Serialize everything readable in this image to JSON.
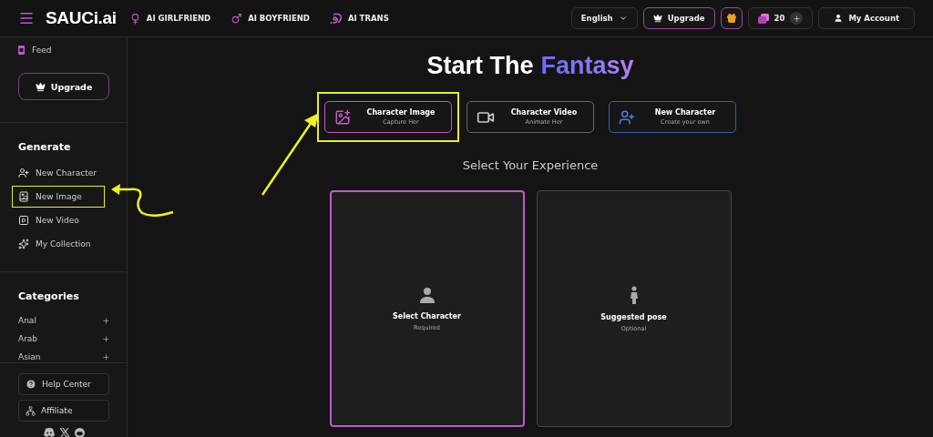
{
  "header": {
    "logo": "SAUCi.ai",
    "nav": [
      {
        "label": "AI GIRLFRIEND",
        "kind": "female"
      },
      {
        "label": "AI BOYFRIEND",
        "kind": "male"
      },
      {
        "label": "AI TRANS",
        "kind": "trans"
      }
    ],
    "language": "English",
    "upgrade": "Upgrade",
    "credits": "20",
    "account": "My Account"
  },
  "sidebar": {
    "feed": "Feed",
    "upgrade": "Upgrade",
    "generate_title": "Generate",
    "generate_items": [
      {
        "label": "New Character",
        "kind": "character",
        "highlighted": false
      },
      {
        "label": "New Image",
        "kind": "image",
        "highlighted": true
      },
      {
        "label": "New Video",
        "kind": "video",
        "highlighted": false
      },
      {
        "label": "My Collection",
        "kind": "collection",
        "highlighted": false
      }
    ],
    "categories_title": "Categories",
    "categories": [
      {
        "label": "Anal",
        "expanded": false
      },
      {
        "label": "Arab",
        "expanded": false
      },
      {
        "label": "Asian",
        "expanded": false
      }
    ],
    "help": "Help Center",
    "affiliate": "Affiliate"
  },
  "main": {
    "title": "Start The",
    "title_accent": "Fantasy",
    "modes": [
      {
        "title": "Character Image",
        "subtitle": "Capture Her",
        "kind": "image",
        "selected": true,
        "highlighted": true
      },
      {
        "title": "Character Video",
        "subtitle": "Animate Her",
        "kind": "video",
        "selected": false,
        "highlighted": false
      },
      {
        "title": "New Character",
        "subtitle": "Create your own",
        "kind": "create",
        "selected": false,
        "highlighted": false
      }
    ],
    "section_title": "Select Your Experience",
    "cards": [
      {
        "title": "Select Character",
        "subtitle": "Required",
        "kind": "character",
        "selected": true
      },
      {
        "title": "Suggested pose",
        "subtitle": "Optional",
        "kind": "pose",
        "selected": false
      }
    ]
  }
}
